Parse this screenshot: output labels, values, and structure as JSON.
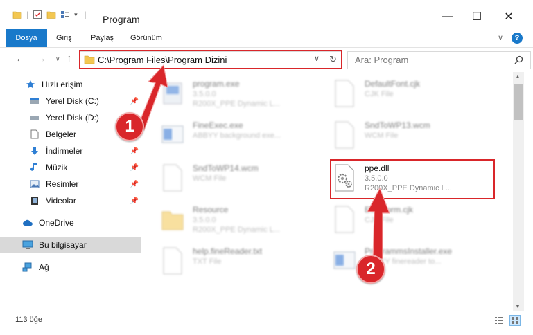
{
  "window": {
    "title": "Program",
    "minimize_glyph": "—",
    "maximize_glyph": "☐",
    "close_glyph": "✕"
  },
  "ribbon": {
    "tabs": [
      "Dosya",
      "Giriş",
      "Paylaş",
      "Görünüm"
    ],
    "collapse_glyph": "∨",
    "help_glyph": "?"
  },
  "address": {
    "path": "C:\\Program Files\\Program Dizini"
  },
  "search": {
    "placeholder": "Ara: Program"
  },
  "sidebar": {
    "items": [
      {
        "label": "Hızlı erişim",
        "icon": "star-icon",
        "pinned": false
      },
      {
        "label": "Yerel Disk (C:)",
        "icon": "drive-icon",
        "pinned": true
      },
      {
        "label": "Yerel Disk (D:)",
        "icon": "drive-icon",
        "pinned": true
      },
      {
        "label": "Belgeler",
        "icon": "documents-icon",
        "pinned": true
      },
      {
        "label": "İndirmeler",
        "icon": "download-icon",
        "pinned": true
      },
      {
        "label": "Müzik",
        "icon": "music-icon",
        "pinned": true
      },
      {
        "label": "Resimler",
        "icon": "pictures-icon",
        "pinned": true
      },
      {
        "label": "Videolar",
        "icon": "videos-icon",
        "pinned": true
      },
      {
        "label": "OneDrive",
        "icon": "cloud-icon",
        "pinned": false
      },
      {
        "label": "Bu bilgisayar",
        "icon": "computer-icon",
        "pinned": false,
        "selected": true
      },
      {
        "label": "Ağ",
        "icon": "network-icon",
        "pinned": false
      }
    ]
  },
  "files": [
    {
      "name": "program.exe",
      "sub1": "3.5.0.0",
      "sub2": "R200X_PPE Dynamic L...",
      "type": "exe",
      "blurred": true
    },
    {
      "name": "DefaultFont.cjk",
      "sub1": "CJK File",
      "sub2": "",
      "type": "doc",
      "blurred": true
    },
    {
      "name": "FineExec.exe",
      "sub1": "ABBYY background exe...",
      "sub2": "",
      "type": "window",
      "blurred": true
    },
    {
      "name": "SndToWP13.wcm",
      "sub1": "WCM File",
      "sub2": "",
      "type": "doc",
      "blurred": true
    },
    {
      "name": "SndToWP14.wcm",
      "sub1": "WCM File",
      "sub2": "",
      "type": "doc",
      "blurred": true
    },
    {
      "name": "ppe.dll",
      "sub1": "3.5.0.0",
      "sub2": "R200X_PPE Dynamic L...",
      "type": "dll",
      "blurred": false
    },
    {
      "name": "Resource",
      "sub1": "3.5.0.0",
      "sub2": "R200X_PPE Dynamic L...",
      "type": "folder",
      "blurred": true
    },
    {
      "name": "EulaForm.cjk",
      "sub1": "CJK File",
      "sub2": "",
      "type": "doc",
      "blurred": true
    },
    {
      "name": "help.fineReader.txt",
      "sub1": "TXT File",
      "sub2": "",
      "type": "doc",
      "blurred": true
    },
    {
      "name": "ProgrammsInstaller.exe",
      "sub1": "ABBYY finereader to...",
      "sub2": "",
      "type": "window",
      "blurred": true
    }
  ],
  "status": {
    "count": "113 öğe"
  },
  "annotations": {
    "badge1": "1",
    "badge2": "2"
  },
  "colors": {
    "accent": "#1979ca",
    "highlight": "#d9262a",
    "selected_bg": "#cce8ff"
  }
}
